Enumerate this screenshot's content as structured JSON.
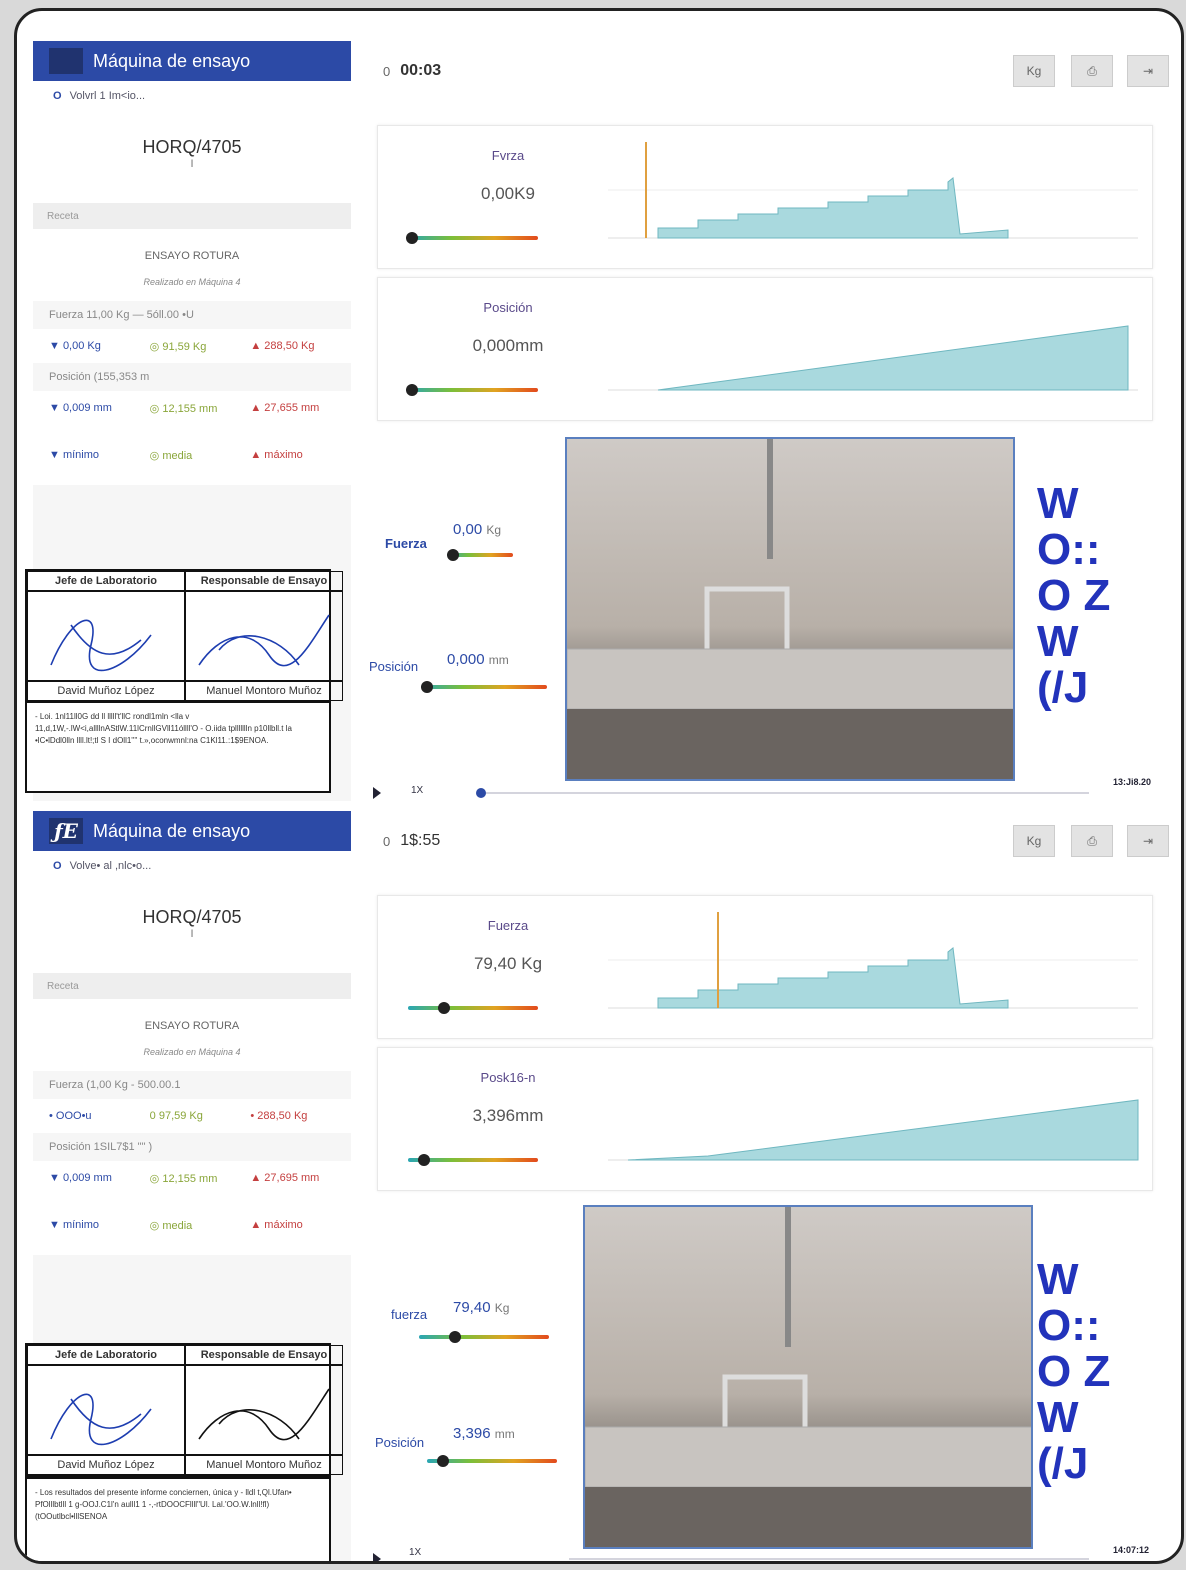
{
  "panels": [
    {
      "app_title": "Máquina de ensayo",
      "back_label": "Volvrl 1 Im<io...",
      "code": "HORQ/4705",
      "code_sub": "I",
      "section_label": "Receta",
      "recipe": "ENSAYO ROTURA",
      "recipe_by": "Realizado en Máquina 4",
      "force_row": "Fuerza 11,00 Kg — 5óll.00 •U",
      "force_min": "▼ 0,00 Kg",
      "force_med": "◎ 91,59 Kg",
      "force_max": "▲ 288,50 Kg",
      "pos_row": "Posición (155,353 m",
      "pos_min": "▼ 0,009 mm",
      "pos_med": "◎ 12,155 mm",
      "pos_max": "▲ 27,655 mm",
      "legend_min": "▼ mínimo",
      "legend_med": "◎ media",
      "legend_max": "▲ máximo",
      "sig_left_title": "Jefe de Laboratorio",
      "sig_right_title": "Responsable de Ensayo",
      "sig_left_name": "David Muñoz López",
      "sig_right_name": "Manuel Montoro Muñoz",
      "notes": "- Loi. 1nl11ll0G dd ll lllll't'llC rondl1mln <lla v 11,d,1W,-.lW<i,allllnAStlW.11lCrnllGVll11óllll'O - O.iida tpllllllln p10llbll.t la •lC•lDdl0lln llll.lt!;tl S I dOll1'''' t.»,oconwmnl:na C1Kl11.:1$9ENOA.",
      "time": "00:03",
      "time_prefix": "0",
      "unit_btn": "Kg",
      "print_icon": "print-icon",
      "exit_icon": "exit-icon",
      "force_label": "Fvrza",
      "force_value": "0,00K9",
      "pos_label": "Posición",
      "pos_value": "0,000mm",
      "video_force_label": "Fuerza",
      "video_force_value": "0,00",
      "video_force_unit": "Kg",
      "video_pos_label": "Posición",
      "video_pos_value": "0,000",
      "video_pos_unit": "mm",
      "speed": "1X",
      "clock": "13:Ji8.20",
      "deco_text": "W O:: O Z W (/J"
    },
    {
      "app_title": "Máquina de ensayo",
      "back_label": "Volve• al ,nlc•o...",
      "code": "HORQ/4705",
      "code_sub": "I",
      "section_label": "Receta",
      "recipe": "ENSAYO ROTURA",
      "recipe_by": "Realizado en Máquina 4",
      "force_row": "Fuerza (1,00 Kg - 500.00.1",
      "force_min": "• OOO•u",
      "force_med": "0 97,59 Kg",
      "force_max": "• 288,50 Kg",
      "pos_row": "Posición 1SIL7$1 \"\" )",
      "pos_min": "▼ 0,009 mm",
      "pos_med": "◎ 12,155 mm",
      "pos_max": "▲ 27,695 mm",
      "legend_min": "▼ mínimo",
      "legend_med": "◎ media",
      "legend_max": "▲ máximo",
      "sig_left_title": "Jefe de Laboratorio",
      "sig_right_title": "Responsable de Ensayo",
      "sig_left_name": "David Muñoz López",
      "sig_right_name": "Manuel Montoro Muñoz",
      "notes": "- Los resultados del presente informe conciernen, única y - lldl t,Ql.Ufan• PfOlllbtlll 1 g-OOJ.C1l'n aulll1 1 -,-rtDOOCFllll''Ul. Lal.'OO.W.lnll!fl)(tOOutlbcl•lllSENOA",
      "time": "1$:55",
      "time_prefix": "0",
      "unit_btn": "Kg",
      "print_icon": "print-icon",
      "exit_icon": "exit-icon",
      "force_label": "Fuerza",
      "force_value": "79,40 Kg",
      "pos_label": "Posk16-n",
      "pos_value": "3,396mm",
      "video_force_label": "fuerza",
      "video_force_value": "79,40",
      "video_force_unit": "Kg",
      "video_pos_label": "Posición",
      "video_pos_value": "3,396",
      "video_pos_unit": "mm",
      "speed": "1X",
      "clock": "14:07:12",
      "deco_text": "W O:: O Z W (/J"
    }
  ],
  "colors": {
    "accent": "#2c4aa6",
    "chart_fill": "#a9d9de",
    "cursor": "#e0a040"
  }
}
